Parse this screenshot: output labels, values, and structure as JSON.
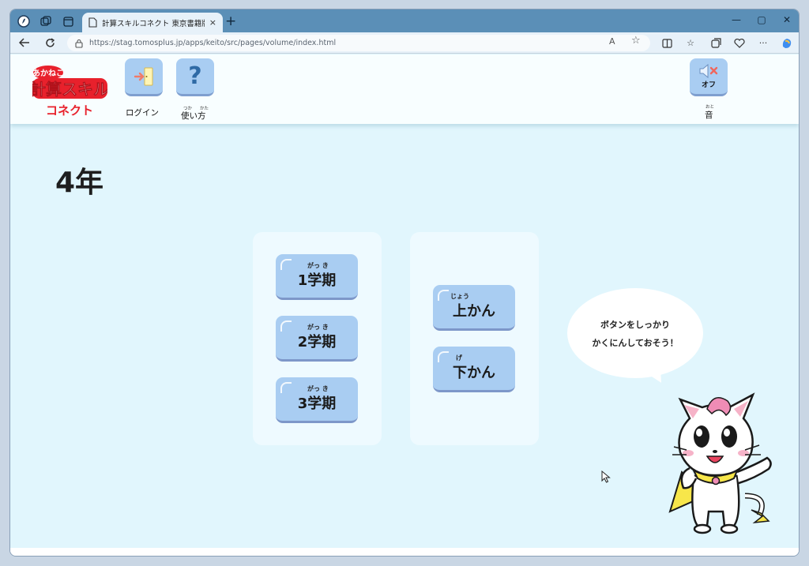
{
  "browser": {
    "tab_title": "計算スキルコネクト 東京書籍版",
    "tab_close": "×",
    "new_tab": "+",
    "url": "https://stag.tomosplus.jp/apps/keito/src/pages/volume/index.html",
    "read_aloud": "A",
    "window_controls": {
      "minimize": "—",
      "maximize": "▢",
      "close": "✕"
    },
    "more": "···"
  },
  "header": {
    "logo": {
      "top": "あかねこ",
      "main": "計算スキル",
      "bottom": "コネクト"
    },
    "login": {
      "label": "ログイン"
    },
    "howto": {
      "label": "使い方",
      "ruby_1": "つか",
      "ruby_2": "かた",
      "icon_text": "?"
    },
    "sound": {
      "icon_text": "オフ",
      "label": "音",
      "ruby": "おと"
    }
  },
  "main": {
    "grade": "4年",
    "terms": [
      {
        "label": "1学期",
        "ruby": "がっ き"
      },
      {
        "label": "2学期",
        "ruby": "がっ き"
      },
      {
        "label": "3学期",
        "ruby": "がっ き"
      }
    ],
    "volumes": [
      {
        "label": "上かん",
        "ruby": "じょう"
      },
      {
        "label": "下かん",
        "ruby": "げ"
      }
    ],
    "speech_bubble": {
      "line1": "ボタンをしっかり",
      "line2": "かくにんしておそう！"
    }
  },
  "colors": {
    "page_bg": "#e1f6fd",
    "button": "#a9cdf2",
    "panel": "#eefaff",
    "logo_red": "#e8212c",
    "titlebar": "#5b8fb7"
  }
}
